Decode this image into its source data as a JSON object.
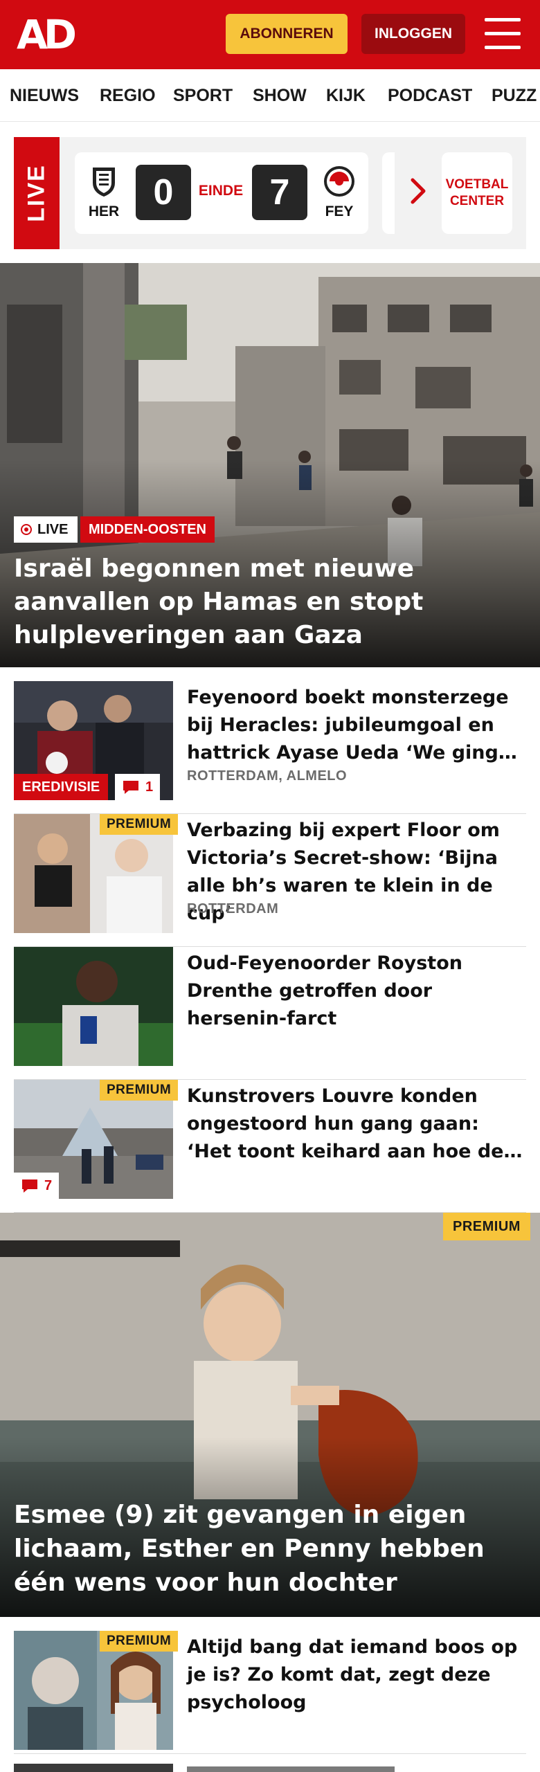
{
  "header": {
    "logo": "AD",
    "subscribe_label": "ABONNEREN",
    "login_label": "INLOGGEN",
    "menu_icon": "hamburger-icon"
  },
  "nav": {
    "items": [
      "NIEUWS",
      "REGIO",
      "SPORT",
      "SHOW",
      "KIJK",
      "PODCAST",
      "PUZZ"
    ]
  },
  "scorebar": {
    "live_label": "LIVE",
    "match": {
      "home": "HER",
      "home_score": "0",
      "status": "EINDE",
      "away_score": "7",
      "away": "FEY"
    },
    "arrow_icon": "chevron-right-icon",
    "voetbal_center": "VOETBAL\nCENTER"
  },
  "hero": {
    "live_label": "LIVE",
    "category": "MIDDEN-OOSTEN",
    "title": "Israël begonnen met nieuwe aanvallen op Hamas en stopt hulpleveringen aan Gaza"
  },
  "articles": [
    {
      "title": "Feyenoord boekt monsterzege bij Heracles: jubileumgoal en hattrick Ayase Ueda ‘We gingen erop en erover’",
      "location": "ROTTERDAM, ALMELO",
      "category": "EREDIVISIE",
      "comments": "1"
    },
    {
      "title": "Verbazing bij expert Floor om Victoria’s Secret-show: ‘Bijna alle bh’s waren te klein in de cup’",
      "location": "ROTTERDAM",
      "premium": "PREMIUM"
    },
    {
      "title": "Oud-Feyenoorder Royston Drenthe getroffen door hersenin-farct"
    },
    {
      "title": "Kunstrovers Louvre konden ongestoord hun gang gaan: ‘Het toont keihard aan hoe de beveiliging faalt’",
      "premium": "PREMIUM",
      "comments": "7"
    }
  ],
  "feature": {
    "premium": "PREMIUM",
    "title": "Esmee (9) zit gevangen in eigen lichaam, Esther en Penny hebben één wens voor hun dochter"
  },
  "article_last": {
    "title": "Altijd bang dat iemand boos op je is? Zo komt dat, zegt deze psycholoog",
    "premium": "PREMIUM"
  },
  "colors": {
    "brand_red": "#d10a11",
    "premium_yellow": "#f7c43b",
    "login_dark_red": "#9b0b0f"
  }
}
